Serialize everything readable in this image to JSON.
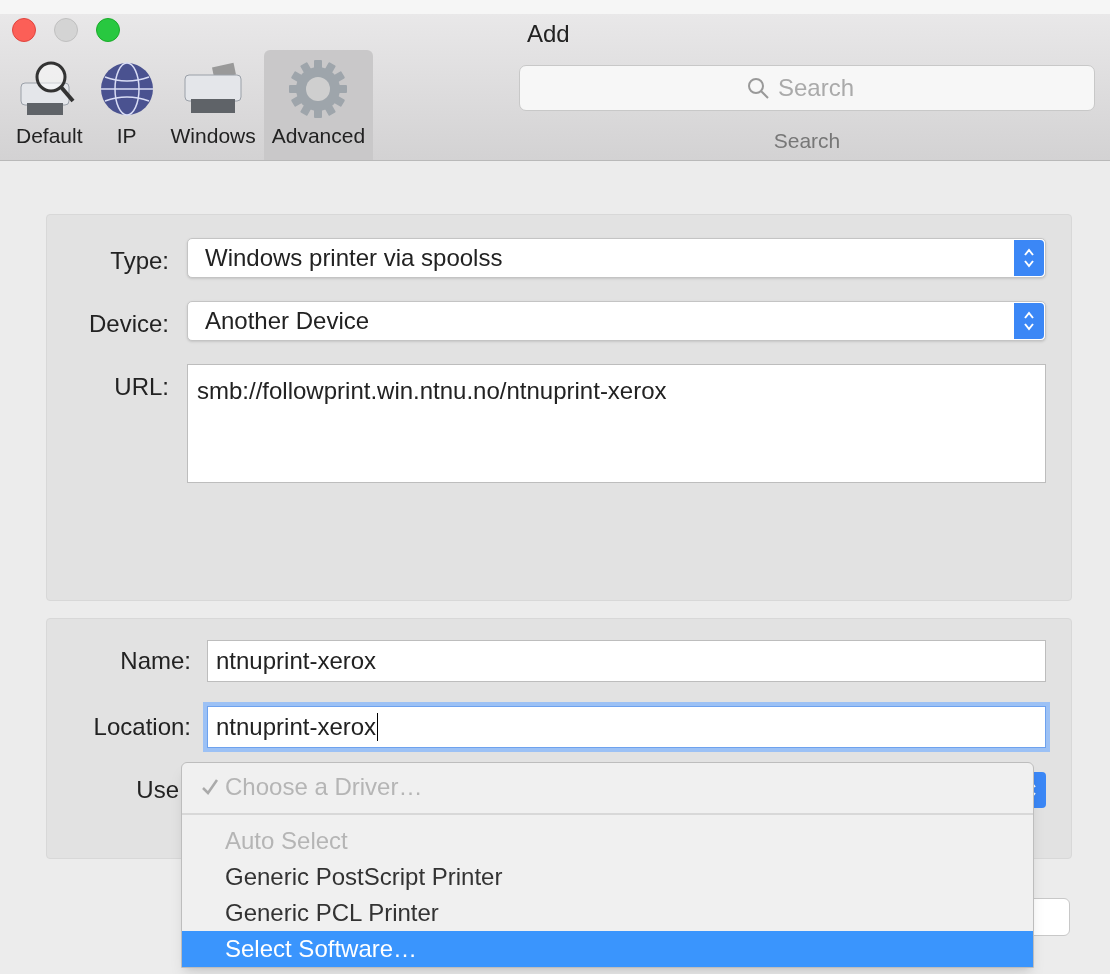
{
  "window": {
    "title": "Add"
  },
  "toolbar": [
    {
      "label": "Default",
      "kind": "printer-search",
      "selected": false
    },
    {
      "label": "IP",
      "kind": "globe",
      "selected": false
    },
    {
      "label": "Windows",
      "kind": "printer",
      "selected": false
    },
    {
      "label": "Advanced",
      "kind": "gear",
      "selected": true
    }
  ],
  "search": {
    "placeholder": "Search",
    "label": "Search"
  },
  "connection": [
    {
      "label": "Type:",
      "kind": "popup",
      "value": "Windows printer via spoolss"
    },
    {
      "label": "Device:",
      "kind": "popup",
      "value": "Another Device"
    },
    {
      "label": "URL:",
      "kind": "textarea",
      "value": "smb://followprint.win.ntnu.no/ntnuprint-xerox"
    }
  ],
  "details": [
    {
      "label": "Name:",
      "value": "ntnuprint-xerox",
      "focused": false
    },
    {
      "label": "Location:",
      "value": "ntnuprint-xerox",
      "focused": true
    }
  ],
  "use": {
    "label": "Use"
  },
  "driver_menu": [
    {
      "kind": "option",
      "label": "Choose a Driver…",
      "checked": true,
      "disabled": true,
      "selected": false
    },
    {
      "kind": "separator"
    },
    {
      "kind": "option",
      "label": "Auto Select",
      "checked": false,
      "disabled": true,
      "selected": false
    },
    {
      "kind": "option",
      "label": "Generic PostScript Printer",
      "checked": false,
      "disabled": false,
      "selected": false
    },
    {
      "kind": "option",
      "label": "Generic PCL Printer",
      "checked": false,
      "disabled": false,
      "selected": false
    },
    {
      "kind": "option",
      "label": "Select Software…",
      "checked": false,
      "disabled": false,
      "selected": true
    }
  ]
}
